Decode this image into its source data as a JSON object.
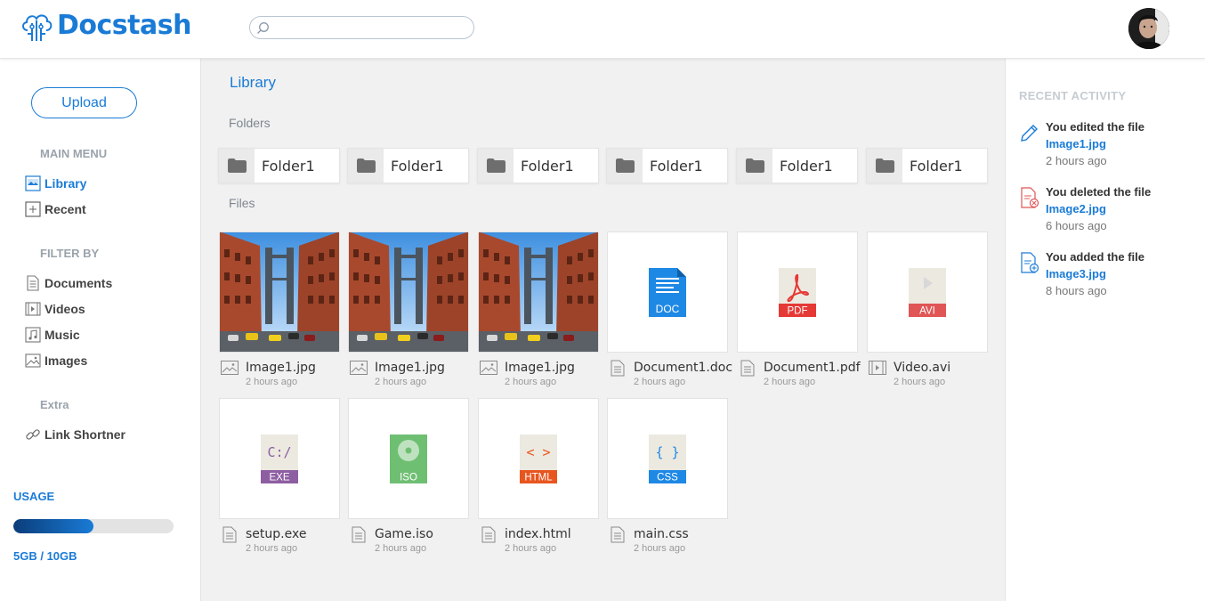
{
  "app": {
    "brand": "Docstash",
    "brand_color": "#1a7bd6"
  },
  "search": {
    "placeholder": "",
    "value": ""
  },
  "sidebar": {
    "upload_label": "Upload",
    "main_menu_title": "MAIN MENU",
    "main_menu": [
      {
        "label": "Library",
        "icon": "library-icon",
        "active": true
      },
      {
        "label": "Recent",
        "icon": "recent-icon",
        "active": false
      }
    ],
    "filter_title": "FILTER BY",
    "filters": [
      {
        "label": "Documents",
        "icon": "document-icon"
      },
      {
        "label": "Videos",
        "icon": "video-icon"
      },
      {
        "label": "Music",
        "icon": "music-icon"
      },
      {
        "label": "Images",
        "icon": "image-icon"
      }
    ],
    "extra_title": "Extra",
    "extra": [
      {
        "label": "Link Shortner",
        "icon": "link-icon"
      }
    ],
    "usage_title": "USAGE",
    "usage_text": "5GB / 10GB",
    "usage_fraction": 0.5
  },
  "main": {
    "title": "Library",
    "folders_title": "Folders",
    "files_title": "Files",
    "folders": [
      "Folder1",
      "Folder1",
      "Folder1",
      "Folder1",
      "Folder1",
      "Folder1"
    ],
    "files": [
      {
        "name": "Image1.jpg",
        "time": "2 hours ago",
        "kind": "image",
        "badge": ""
      },
      {
        "name": "Image1.jpg",
        "time": "2 hours ago",
        "kind": "image",
        "badge": ""
      },
      {
        "name": "Image1.jpg",
        "time": "2 hours ago",
        "kind": "image",
        "badge": ""
      },
      {
        "name": "Document1.doc",
        "time": "2 hours ago",
        "kind": "doc",
        "badge": "DOC"
      },
      {
        "name": "Document1.pdf",
        "time": "2 hours ago",
        "kind": "pdf",
        "badge": "PDF"
      },
      {
        "name": "Video.avi",
        "time": "2 hours ago",
        "kind": "avi",
        "badge": "AVI"
      },
      {
        "name": "setup.exe",
        "time": "2 hours ago",
        "kind": "exe",
        "badge": "EXE",
        "glyph": "C:/"
      },
      {
        "name": "Game.iso",
        "time": "2 hours ago",
        "kind": "iso",
        "badge": "ISO"
      },
      {
        "name": "index.html",
        "time": "2 hours ago",
        "kind": "html",
        "badge": "HTML",
        "glyph": "< >"
      },
      {
        "name": "main.css",
        "time": "2 hours ago",
        "kind": "css",
        "badge": "CSS",
        "glyph": "{ }"
      }
    ],
    "badge_colors": {
      "doc": "#1e88e5",
      "pdf": "#e53935",
      "avi": "#e05555",
      "exe": "#8e5ea2",
      "iso": "#6fbf73",
      "html": "#e8561f",
      "css": "#1e88e5"
    }
  },
  "recent": {
    "title": "RECENT ACTIVITY",
    "items": [
      {
        "text": "You edited the file",
        "file": "Image1.jpg",
        "time": "2 hours ago",
        "icon": "pencil-icon"
      },
      {
        "text": "You deleted the file",
        "file": "Image2.jpg",
        "time": "6 hours ago",
        "icon": "file-delete-icon"
      },
      {
        "text": "You added the file",
        "file": "Image3.jpg",
        "time": "8 hours ago",
        "icon": "file-add-icon"
      }
    ]
  }
}
